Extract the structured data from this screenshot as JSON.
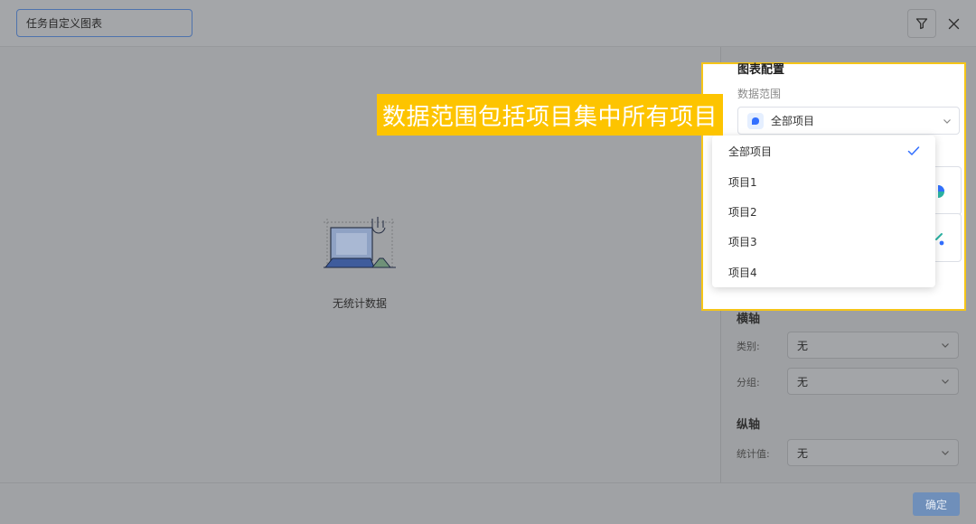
{
  "header": {
    "chart_name": "任务自定义图表"
  },
  "empty_state": {
    "text": "无统计数据"
  },
  "config": {
    "title": "图表配置",
    "data_range_label": "数据范围",
    "data_range_value": "全部项目",
    "x_axis": {
      "title": "横轴",
      "category_label": "类别:",
      "category_value": "无",
      "group_label": "分组:",
      "group_value": "无"
    },
    "y_axis": {
      "title": "纵轴",
      "stat_label": "统计值:",
      "stat_value": "无"
    }
  },
  "dropdown": {
    "options": [
      {
        "label": "全部项目",
        "selected": true
      },
      {
        "label": "项目1",
        "selected": false
      },
      {
        "label": "项目2",
        "selected": false
      },
      {
        "label": "项目3",
        "selected": false
      },
      {
        "label": "项目4",
        "selected": false
      }
    ]
  },
  "callout": {
    "text": "数据范围包括项目集中所有项目"
  },
  "footer": {
    "confirm_label": "确定"
  },
  "icons": [
    "filter-icon",
    "close-icon",
    "chevron-down-icon",
    "check-icon",
    "project-icon",
    "empty-laptop-illustration"
  ],
  "colors": {
    "accent": "#3370ff",
    "highlight": "#f5c518",
    "callout_bg": "#fdc400"
  }
}
